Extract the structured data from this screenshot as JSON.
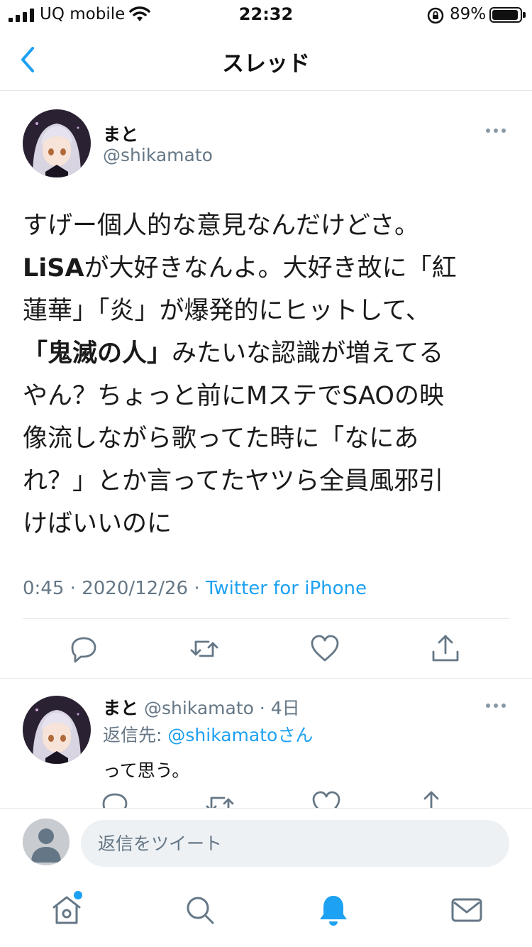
{
  "status_bar": {
    "carrier": "UQ mobile",
    "time": "22:32",
    "battery_percent": "89%"
  },
  "header": {
    "title": "スレッド"
  },
  "tweet": {
    "display_name": "まと",
    "handle": "@shikamato",
    "text_line1": "すげー個人的な意見なんだけどさ。",
    "text_bold1": "LiSA",
    "text_line2": "が大好きなんよ。大好き故に「紅\n蓮華」「炎」が爆発的にヒットして、\n",
    "text_bold2": "「鬼滅の人」",
    "text_line3": "みたいな認識が増えてる\nやん？ちょっと前にMステでSAOの映\n像流しながら歌ってた時に「なにあ\nれ？」とか言ってたヤツら全員風邪引\nけばいいのに",
    "time": "0:45",
    "date": "2020/12/26",
    "source": "Twitter for iPhone"
  },
  "reply": {
    "display_name": "まと",
    "handle": "@shikamato",
    "age": "4日",
    "reply_to_label": "返信先: ",
    "reply_to_handle": "@shikamato",
    "reply_to_suffix": "さん",
    "text": "って思う。"
  },
  "compose": {
    "placeholder": "返信をツイート"
  },
  "icons": {
    "back": "chevron-left-icon",
    "more": "more-dots-icon",
    "reply": "reply-icon",
    "retweet": "retweet-icon",
    "like": "heart-icon",
    "share": "share-icon",
    "home": "home-icon",
    "search": "search-icon",
    "notifications": "bell-icon",
    "messages": "mail-icon"
  },
  "colors": {
    "accent": "#1da1f2",
    "secondary_text": "#657786",
    "icon_gray": "#8899a6",
    "divider": "#e1e8ed"
  }
}
